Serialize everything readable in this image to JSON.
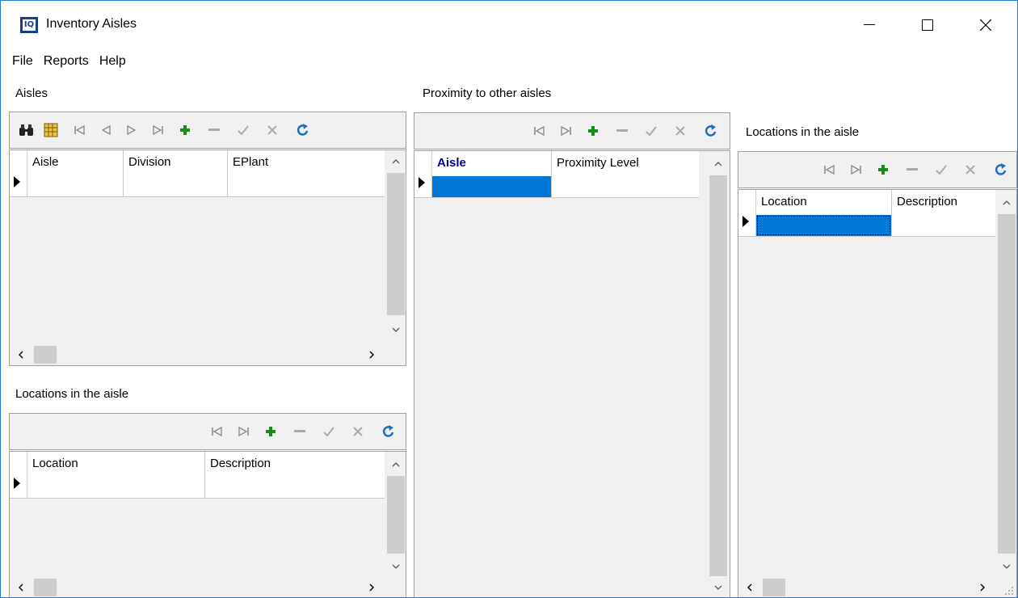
{
  "window": {
    "title": "Inventory Aisles",
    "icon_text": "IQ"
  },
  "menu": {
    "items": [
      "File",
      "Reports",
      "Help"
    ]
  },
  "aisles_panel": {
    "title": "Aisles",
    "columns": [
      "Aisle",
      "Division",
      "EPlant"
    ]
  },
  "aisle_locations_panel": {
    "title": "Locations in the aisle",
    "columns": [
      "Location",
      "Description"
    ]
  },
  "proximity_panel": {
    "title": "Proximity to other aisles",
    "columns": [
      "Aisle",
      "Proximity Level"
    ]
  },
  "proximity_locations_panel": {
    "title": "Locations in the aisle",
    "columns": [
      "Location",
      "Description"
    ]
  },
  "colors": {
    "selection": "#0078d7",
    "add_green": "#1a8a1a",
    "refresh_blue": "#1f6fc5",
    "window_border": "#1f7bd6",
    "header_blue_text": "#00008b"
  },
  "icons": {
    "search": "binoculars-icon",
    "grid": "grid-icon",
    "first": "first-record-icon",
    "prior": "prior-record-icon",
    "next": "next-record-icon",
    "last": "last-record-icon",
    "insert": "plus-icon",
    "delete": "minus-icon",
    "post": "check-icon",
    "cancel": "x-icon",
    "refresh": "refresh-icon"
  }
}
